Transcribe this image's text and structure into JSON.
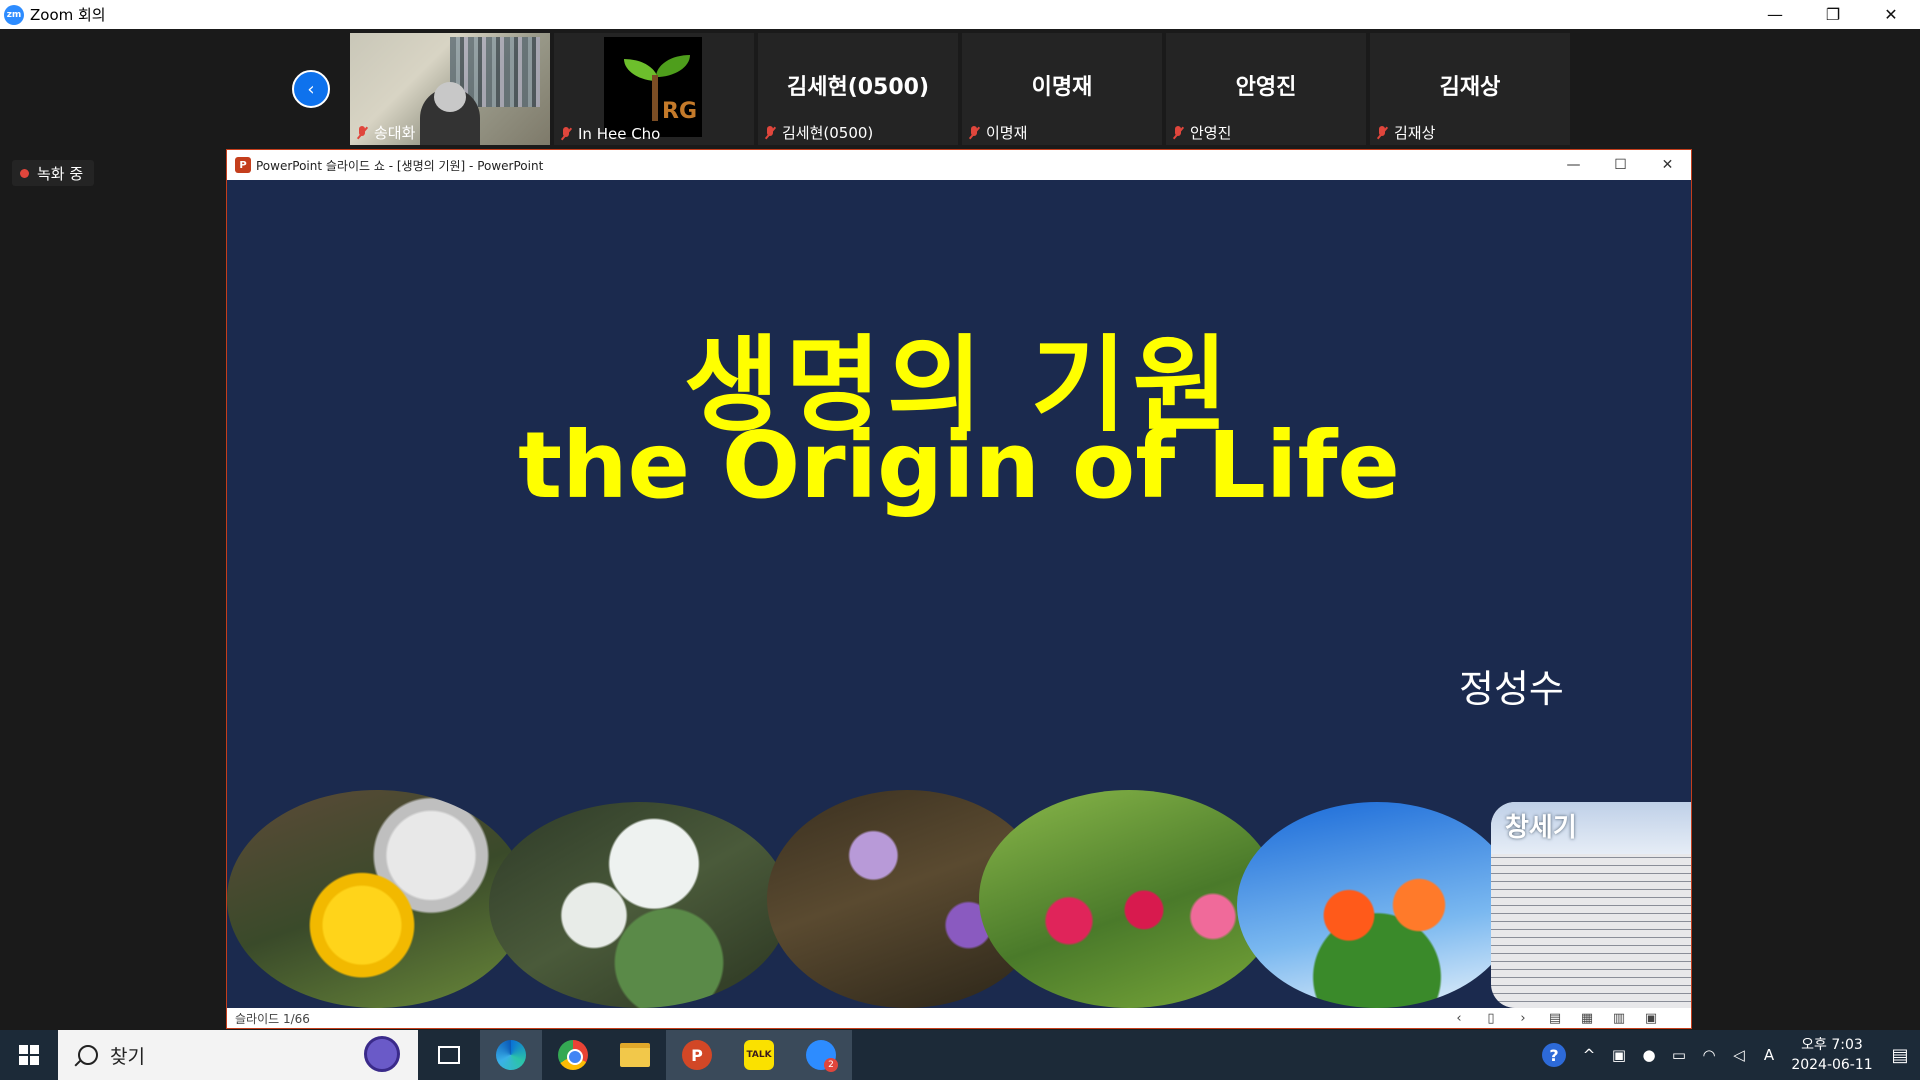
{
  "zoom": {
    "title": "Zoom 회의",
    "logo_text": "zm",
    "controls": {
      "minimize": "—",
      "restore": "❐",
      "close": "✕"
    },
    "prev_button": "‹",
    "recording": "녹화 중"
  },
  "participants": [
    {
      "name": "송대화",
      "big_name": "",
      "video": true
    },
    {
      "name": "In Hee Cho",
      "big_name": "",
      "video": true,
      "logo_text": "RG"
    },
    {
      "name": "김세현(0500)",
      "big_name": "김세현(0500)",
      "video": false
    },
    {
      "name": "이명재",
      "big_name": "이명재",
      "video": false
    },
    {
      "name": "안영진",
      "big_name": "안영진",
      "video": false
    },
    {
      "name": "김재상",
      "big_name": "김재상",
      "video": false
    }
  ],
  "powerpoint": {
    "icon": "P",
    "window_title": "PowerPoint 슬라이드 쇼 - [생명의 기원] - PowerPoint",
    "controls": {
      "minimize": "—",
      "maximize": "☐",
      "close": "✕"
    },
    "slide": {
      "title_korean": "생명의 기원",
      "title_english": "the Origin of Life",
      "author": "정성수",
      "scripture_heading": "창세기"
    },
    "status": {
      "slide_number": "슬라이드 1/66",
      "icons": [
        "‹",
        "▯",
        "›",
        "▤",
        "▦",
        "▥",
        "▣"
      ]
    }
  },
  "taskbar": {
    "search_placeholder": "찾기",
    "apps": [
      "task-view",
      "edge",
      "chrome",
      "file-explorer",
      "powerpoint",
      "kakaotalk",
      "zoom"
    ],
    "ppt_label": "P",
    "kakao_label": "TALK",
    "zoom_badge": "2",
    "tray": {
      "help": "?",
      "chevron": "^",
      "ime": "A",
      "time": "오후 7:03",
      "date": "2024-06-11",
      "notifications": "1"
    }
  }
}
